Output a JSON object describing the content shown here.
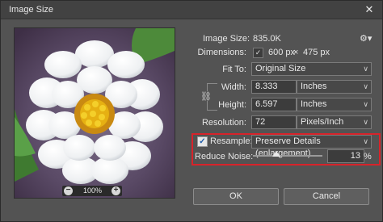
{
  "dialog": {
    "title": "Image Size",
    "close_glyph": "✕"
  },
  "preview": {
    "zoom_label": "100%",
    "zoom_out_glyph": "−",
    "zoom_in_glyph": "+"
  },
  "image_size": {
    "label": "Image Size:",
    "value": "835.0K",
    "gear_glyph": "⚙▾"
  },
  "dimensions": {
    "label": "Dimensions:",
    "check_glyph": "✓",
    "width": "600 px",
    "times": "×",
    "height": "475 px"
  },
  "fit_to": {
    "label": "Fit To:",
    "value": "Original Size"
  },
  "width": {
    "label": "Width:",
    "value": "8.333",
    "unit": "Inches"
  },
  "height": {
    "label": "Height:",
    "value": "6.597",
    "unit": "Inches"
  },
  "link_glyph": "⛓",
  "resolution": {
    "label": "Resolution:",
    "value": "72",
    "unit": "Pixels/Inch"
  },
  "resample": {
    "label": "Resample:",
    "checked": true,
    "check_glyph": "✓",
    "value": "Preserve Details (enlargement)"
  },
  "reduce_noise": {
    "label": "Reduce Noise:",
    "value": "13",
    "unit": "%",
    "level_percent": 13
  },
  "chevron_glyph": "∨",
  "buttons": {
    "ok": "OK",
    "cancel": "Cancel"
  },
  "colors": {
    "dialog_bg": "#535353",
    "highlight": "#d8232a"
  }
}
